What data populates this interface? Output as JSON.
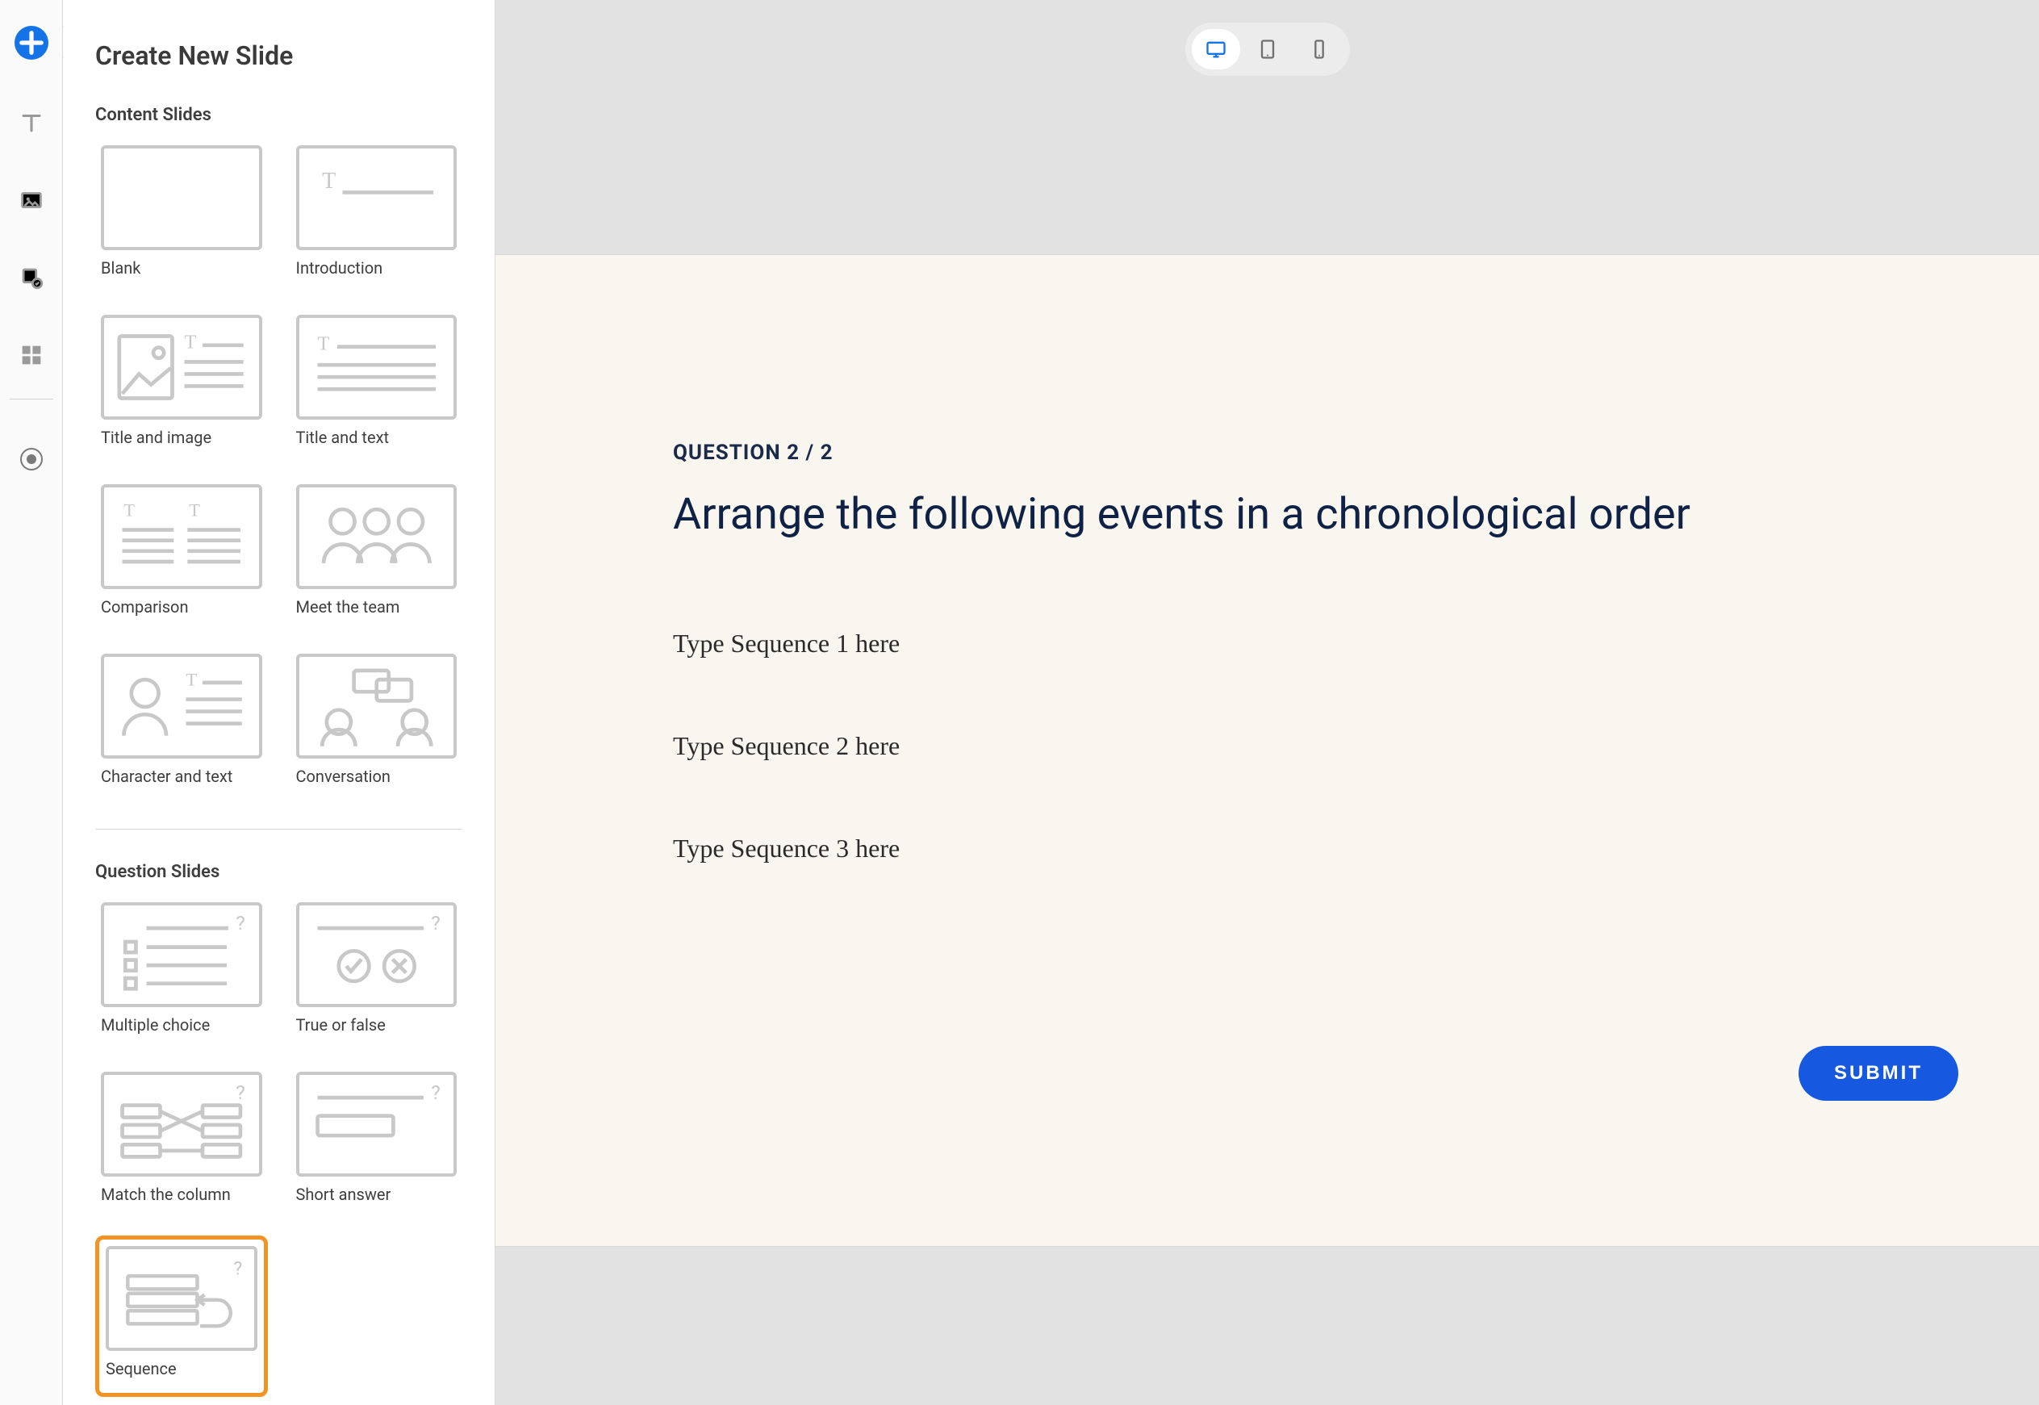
{
  "panel": {
    "title": "Create New Slide",
    "content_heading": "Content Slides",
    "question_heading": "Question Slides",
    "content_templates": [
      {
        "label": "Blank"
      },
      {
        "label": "Introduction"
      },
      {
        "label": "Title and image"
      },
      {
        "label": "Title and text"
      },
      {
        "label": "Comparison"
      },
      {
        "label": "Meet the team"
      },
      {
        "label": "Character and text"
      },
      {
        "label": "Conversation"
      }
    ],
    "question_templates": [
      {
        "label": "Multiple choice"
      },
      {
        "label": "True or false"
      },
      {
        "label": "Match the column"
      },
      {
        "label": "Short answer"
      },
      {
        "label": "Sequence",
        "selected": true
      }
    ]
  },
  "device_switcher": {
    "active": "desktop"
  },
  "slide": {
    "counter": "QUESTION 2 / 2",
    "title": "Arrange the following events in a chronological order",
    "sequence_items": [
      "Type Sequence 1 here",
      "Type Sequence 2 here",
      "Type Sequence 3 here"
    ],
    "submit_label": "SUBMIT"
  }
}
